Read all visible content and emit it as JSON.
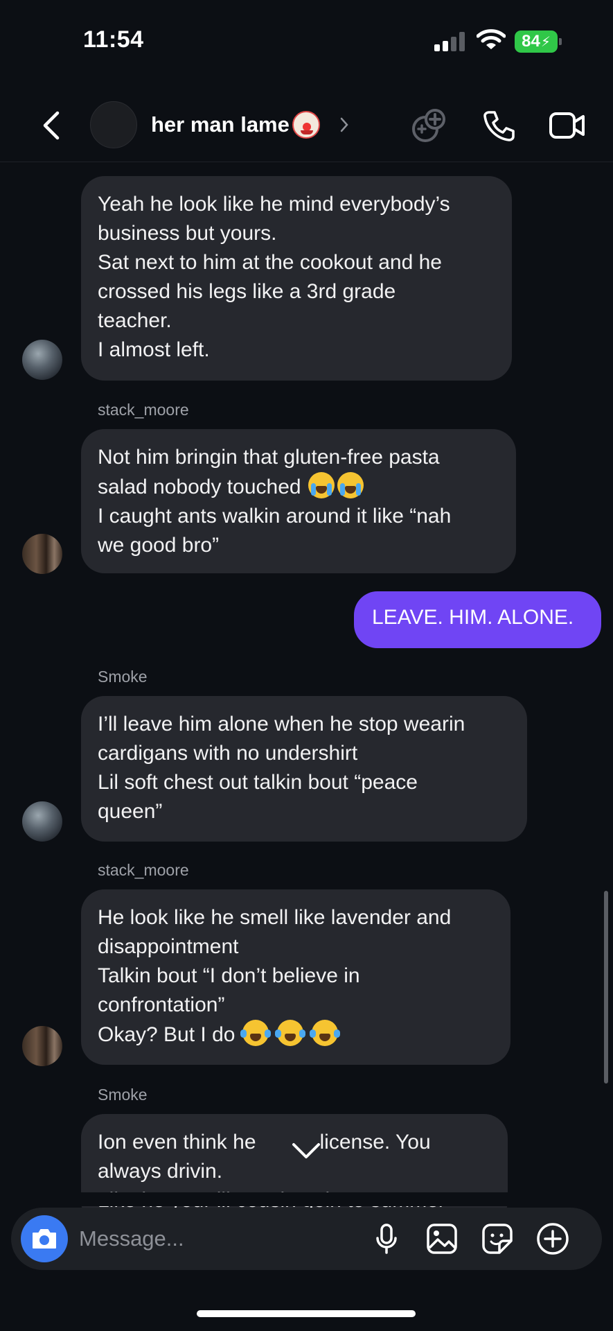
{
  "status_bar": {
    "time": "11:54",
    "battery": "84"
  },
  "header": {
    "title": "her man lame",
    "title_emoji": "clown-face-icon"
  },
  "messages": [
    {
      "sender": "",
      "lines": [
        "Yeah he look like he mind everybody’s",
        "business but yours.",
        "Sat next to him at the cookout and he",
        "crossed his legs like a 3rd grade",
        "teacher.",
        "I almost left."
      ]
    },
    {
      "sender": "stack_moore",
      "lines": [
        "Not him bringin that gluten-free pasta",
        "salad nobody touched",
        "I caught ants walkin around it like “nah",
        "we good bro”"
      ]
    },
    {
      "sender": "me",
      "lines": [
        "LEAVE. HIM. ALONE."
      ]
    },
    {
      "sender": "Smoke",
      "lines": [
        "I’ll leave him alone when he stop wearin",
        "cardigans with no undershirt",
        "Lil soft chest out talkin bout “peace",
        "queen”"
      ]
    },
    {
      "sender": "stack_moore",
      "lines": [
        "He look like he smell like lavender and",
        "disappointment",
        "Talkin bout “I don’t believe in",
        "confrontation”",
        "Okay? But I do"
      ]
    },
    {
      "sender": "Smoke",
      "lines": [
        "Ion even think he",
        "license. You",
        "always drivin.",
        "Like he your lil cousin goin to summer"
      ]
    }
  ],
  "composer": {
    "placeholder": "Message..."
  },
  "colors": {
    "background": "#0c0f14",
    "bubble_incoming": "#26282e",
    "bubble_outgoing": "#7045f4",
    "camera_button": "#3a7af2",
    "battery": "#30c748"
  }
}
